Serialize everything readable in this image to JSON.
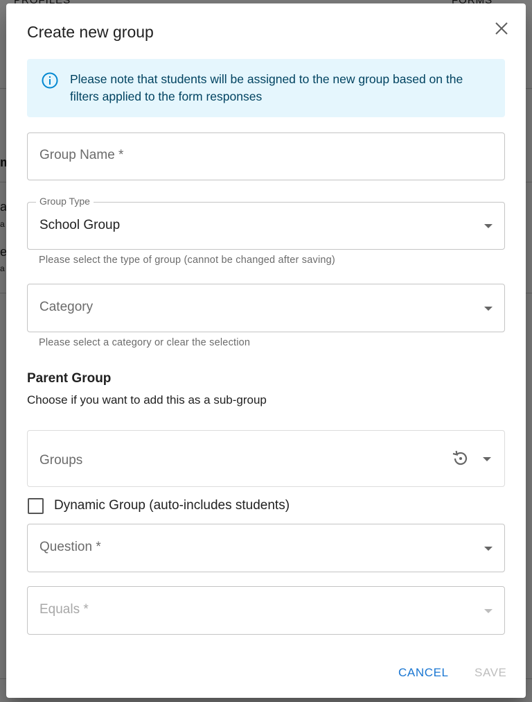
{
  "background": {
    "left_fragments": [
      "m",
      "a",
      "a",
      "e",
      "a"
    ],
    "top_fragments": [
      "PROFILES",
      "FORMS"
    ]
  },
  "dialog": {
    "title": "Create new group",
    "close_icon": "close-icon"
  },
  "alert": {
    "icon": "info-icon",
    "text": "Please note that students will be assigned to the new group based on the filters applied to the form responses",
    "color": "#014361",
    "background": "#e5f6fd"
  },
  "group_name": {
    "placeholder": "Group Name *"
  },
  "group_type": {
    "label": "Group Type",
    "value": "School Group",
    "helper": "Please select the type of group (cannot be changed after saving)"
  },
  "category": {
    "placeholder": "Category",
    "helper": "Please select a category or clear the selection"
  },
  "parent_group": {
    "title": "Parent Group",
    "subtitle": "Choose if you want to add this as a sub-group"
  },
  "groups": {
    "placeholder": "Groups",
    "reset_icon": "reset-icon"
  },
  "dynamic_group": {
    "label": "Dynamic Group (auto-includes students)",
    "checked": false
  },
  "question": {
    "placeholder": "Question *"
  },
  "equals": {
    "placeholder": "Equals *"
  },
  "footer": {
    "cancel_label": "CANCEL",
    "save_label": "SAVE",
    "primary_color": "#1976d2"
  }
}
